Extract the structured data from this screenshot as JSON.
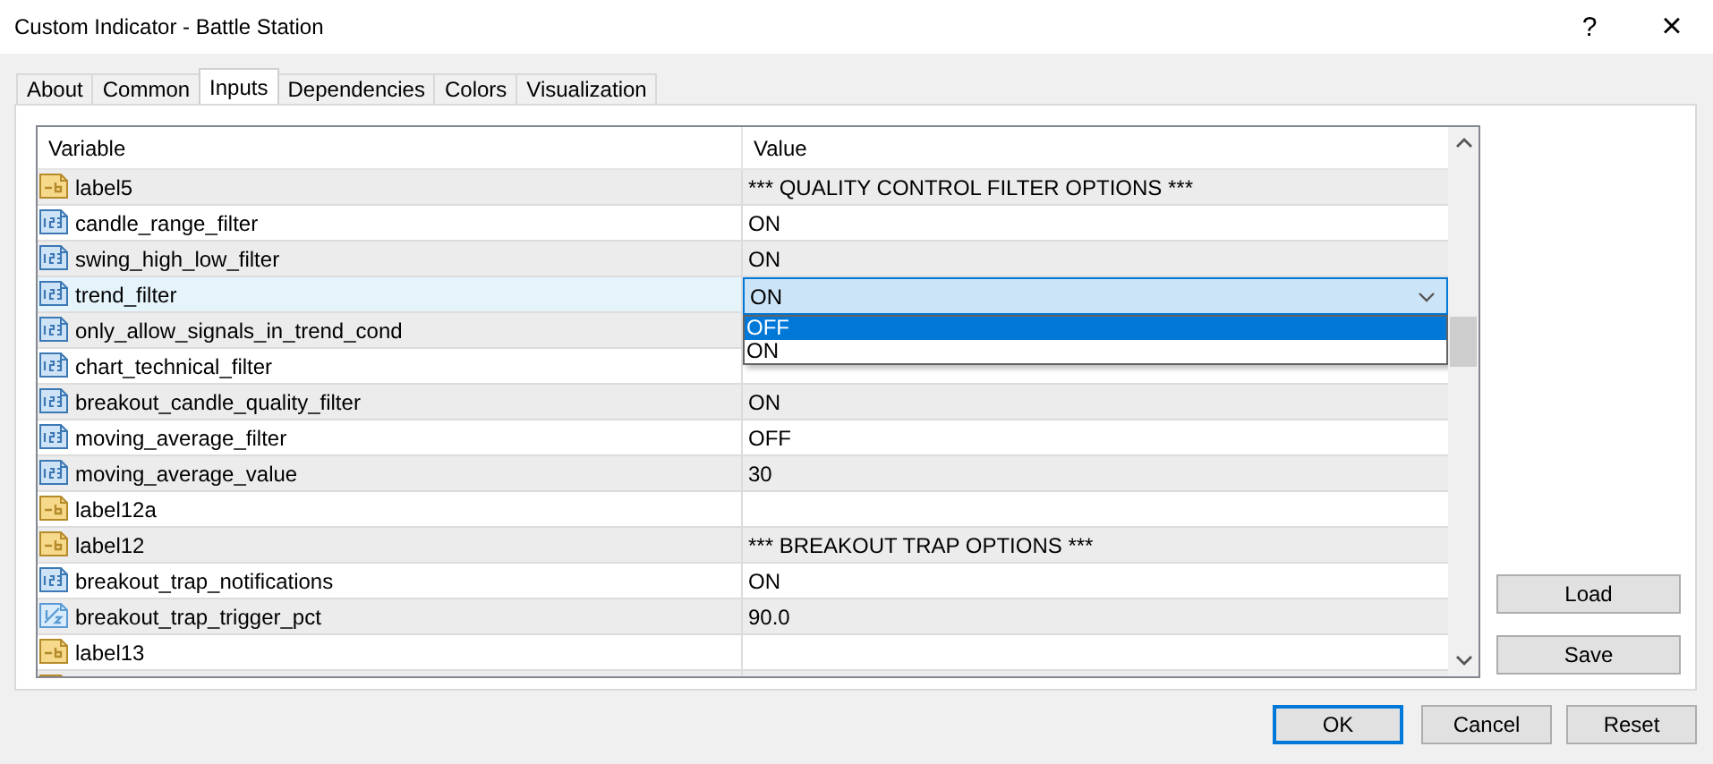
{
  "window": {
    "title": "Custom Indicator - Battle Station",
    "help": "?",
    "close": "×"
  },
  "tabs": [
    {
      "label": "About",
      "selected": false
    },
    {
      "label": "Common",
      "selected": false
    },
    {
      "label": "Inputs",
      "selected": true
    },
    {
      "label": "Dependencies",
      "selected": false
    },
    {
      "label": "Colors",
      "selected": false
    },
    {
      "label": "Visualization",
      "selected": false
    }
  ],
  "table": {
    "columns": [
      "Variable",
      "Value"
    ],
    "rows": [
      {
        "kind": "text",
        "variable": "label5",
        "value": "*** QUALITY CONTROL FILTER OPTIONS ***",
        "selected": false
      },
      {
        "kind": "int",
        "variable": "candle_range_filter",
        "value": "ON",
        "selected": false
      },
      {
        "kind": "int",
        "variable": "swing_high_low_filter",
        "value": "ON",
        "selected": false
      },
      {
        "kind": "int",
        "variable": "trend_filter",
        "value": "ON",
        "selected": true,
        "dropdown": {
          "options": [
            {
              "label": "OFF",
              "selected": true
            },
            {
              "label": "ON",
              "selected": false
            }
          ]
        }
      },
      {
        "kind": "int",
        "variable": "only_allow_signals_in_trend_cond",
        "selected": false
      },
      {
        "kind": "int",
        "variable": "chart_technical_filter",
        "selected": false
      },
      {
        "kind": "int",
        "variable": "breakout_candle_quality_filter",
        "value": "ON",
        "selected": false
      },
      {
        "kind": "int",
        "variable": "moving_average_filter",
        "value": "OFF",
        "selected": false
      },
      {
        "kind": "int",
        "variable": "moving_average_value",
        "value": "30",
        "selected": false
      },
      {
        "kind": "text",
        "variable": "label12a",
        "selected": false
      },
      {
        "kind": "text",
        "variable": "label12",
        "value": "*** BREAKOUT TRAP OPTIONS ***",
        "selected": false
      },
      {
        "kind": "int",
        "variable": "breakout_trap_notifications",
        "value": "ON",
        "selected": false
      },
      {
        "kind": "double",
        "variable": "breakout_trap_trigger_pct",
        "value": "90.0",
        "selected": false
      },
      {
        "kind": "text",
        "variable": "label13",
        "selected": false
      },
      {
        "kind": "text",
        "selected": false
      }
    ]
  },
  "side_buttons": [
    "Load",
    "Save"
  ],
  "buttons": [
    {
      "label": "OK",
      "default": true
    },
    {
      "label": "Cancel",
      "default": false
    },
    {
      "label": "Reset",
      "default": false
    }
  ]
}
